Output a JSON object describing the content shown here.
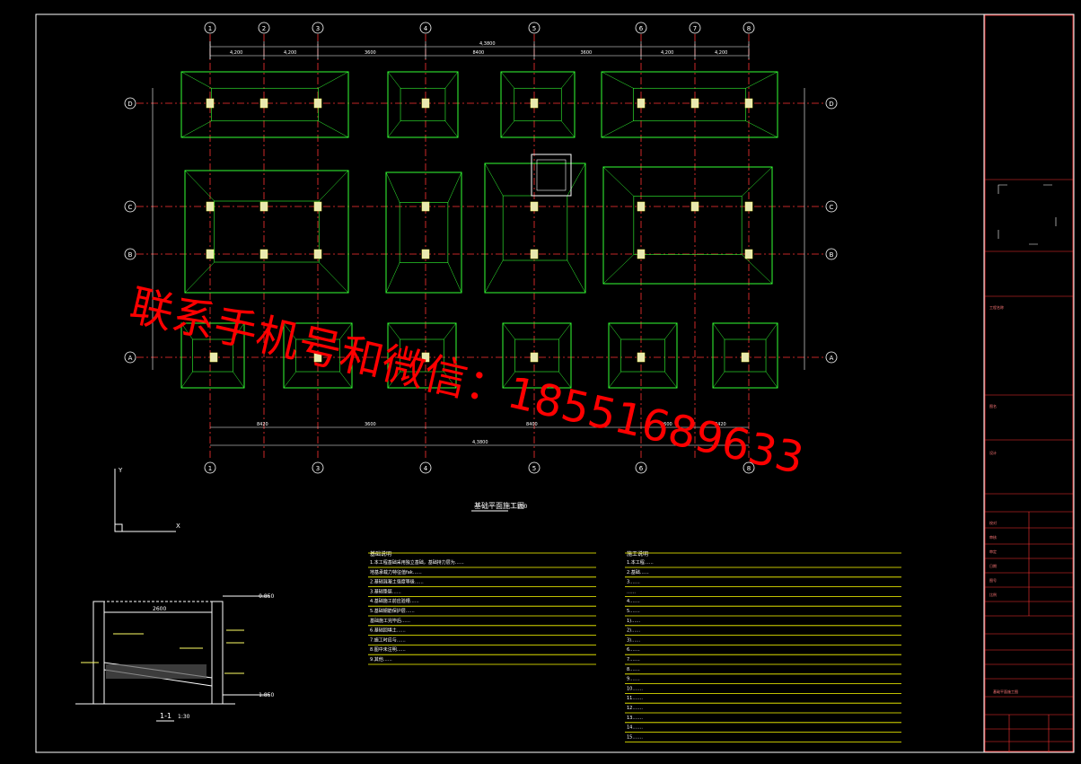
{
  "drawing": {
    "grid_top_labels": [
      "1",
      "2",
      "3",
      "4",
      "5",
      "6",
      "7",
      "8"
    ],
    "grid_bottom_labels": [
      "1",
      "3",
      "4",
      "5",
      "6",
      "8"
    ],
    "grid_row_labels": [
      "D",
      "C",
      "B",
      "A"
    ],
    "top_dims": [
      "4,200",
      "4,200",
      "3600",
      "8400",
      "3600",
      "4,200",
      "4,200"
    ],
    "overall_dim": "4,3800",
    "bottom_dims": [
      "8420",
      "3600",
      "8400",
      "3600",
      "8420"
    ],
    "plan_title": "基础平面施工图",
    "plan_scale": "1:100",
    "section_title": "1-1",
    "section_scale": "1:30",
    "section_dim": "2600",
    "elev_top": "-0.850",
    "elev_bottom": "-1.850",
    "axis_y": "Y",
    "axis_x": "X",
    "watermark": "联系手机号和微信：18551689633"
  },
  "notes_left": {
    "heading": "基础说明",
    "lines": [
      "1.本工程基础采用独立基础，基础持力层为……",
      "  地基承载力特征值fak……",
      "2.基础混凝土强度等级……",
      "3.基础垫层……",
      "4.基础施工前应验槽……",
      "5.基础钢筋保护层……",
      "  基础施工完毕后……",
      "6.基础回填土……",
      "7.施工时应与……",
      "8.图中未注明……",
      "9.其他……"
    ]
  },
  "notes_right": {
    "heading": "施工说明",
    "lines": [
      "1.本工程……",
      "2.基础……",
      "3.……",
      "  ……",
      "4.……",
      "5.……",
      "  1)……",
      "  2)……",
      "  3)……",
      "6.……",
      "7.……",
      "8.……",
      "9.……",
      "10.……",
      "11.……",
      "12.……",
      "13.……",
      "14.……",
      "15.……"
    ]
  },
  "title_block": {
    "cells": [
      "工程名称",
      "图名",
      "设计",
      "校对",
      "审核",
      "审定",
      "日期",
      "图号",
      "比例",
      "基础平面施工图"
    ]
  },
  "colors": {
    "background": "#000000",
    "frame": "#ffffff",
    "titleblock": "#ff3333",
    "footing": "#33ff33",
    "axis": "#ff3333",
    "column": "#ffff66",
    "dims": "#ffffff",
    "notes_line": "#ffff00",
    "watermark": "#ff0000"
  }
}
